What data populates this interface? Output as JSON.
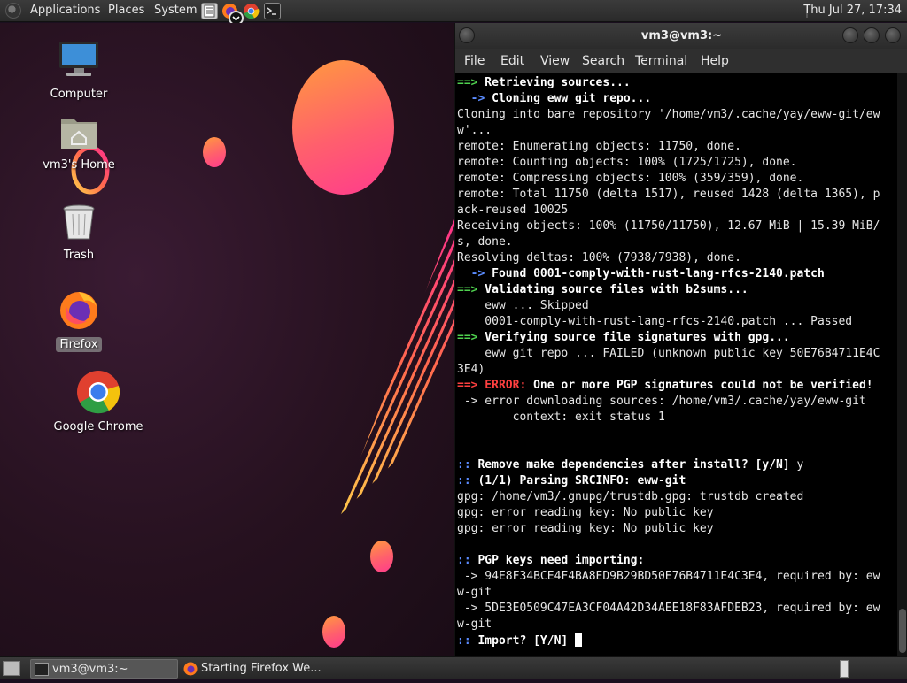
{
  "top_panel": {
    "menus": [
      "Applications",
      "Places",
      "System"
    ],
    "clock": "Thu Jul 27, 17:34"
  },
  "desktop": {
    "icons": [
      {
        "label": "Computer"
      },
      {
        "label": "vm3's Home"
      },
      {
        "label": "Trash"
      },
      {
        "label": "Firefox"
      },
      {
        "label": "Google Chrome"
      }
    ]
  },
  "terminal": {
    "title": "vm3@vm3:~",
    "menus": [
      "File",
      "Edit",
      "View",
      "Search",
      "Terminal",
      "Help"
    ],
    "lines": [
      "==> Retrieving sources...",
      "  -> Cloning eww git repo...",
      "Cloning into bare repository '/home/vm3/.cache/yay/eww-git/ew",
      "w'...",
      "remote: Enumerating objects: 11750, done.",
      "remote: Counting objects: 100% (1725/1725), done.",
      "remote: Compressing objects: 100% (359/359), done.",
      "remote: Total 11750 (delta 1517), reused 1428 (delta 1365), p",
      "ack-reused 10025",
      "Receiving objects: 100% (11750/11750), 12.67 MiB | 15.39 MiB/",
      "s, done.",
      "Resolving deltas: 100% (7938/7938), done.",
      "  -> Found 0001-comply-with-rust-lang-rfcs-2140.patch",
      "==> Validating source files with b2sums...",
      "    eww ... Skipped",
      "    0001-comply-with-rust-lang-rfcs-2140.patch ... Passed",
      "==> Verifying source file signatures with gpg...",
      "    eww git repo ... FAILED (unknown public key 50E76B4711E4C",
      "3E4)",
      "==> ERROR: One or more PGP signatures could not be verified!",
      " -> error downloading sources: /home/vm3/.cache/yay/eww-git",
      "        context: exit status 1",
      "",
      "",
      ":: Remove make dependencies after install? [y/N] y",
      ":: (1/1) Parsing SRCINFO: eww-git",
      "gpg: /home/vm3/.gnupg/trustdb.gpg: trustdb created",
      "gpg: error reading key: No public key",
      "gpg: error reading key: No public key",
      "",
      ":: PGP keys need importing:",
      " -> 94E8F34BCE4F4BA8ED9B29BD50E76B4711E4C3E4, required by: ew",
      "w-git",
      " -> 5DE3E0509C47EA3CF04A42D34AEE18F83AFDEB23, required by: ew",
      "w-git",
      ":: Import? [Y/N] "
    ]
  },
  "taskbar": {
    "tasks": [
      {
        "label": "vm3@vm3:~",
        "active": true
      },
      {
        "label": "Starting Firefox We...",
        "active": false
      }
    ]
  },
  "colors": {
    "prompt_green": "#4fd24f",
    "arrow_blue": "#5b8cff",
    "error_red": "#ff4040",
    "orb_gradient_start": "#ff9a3e",
    "orb_gradient_end": "#ff3b8d"
  }
}
